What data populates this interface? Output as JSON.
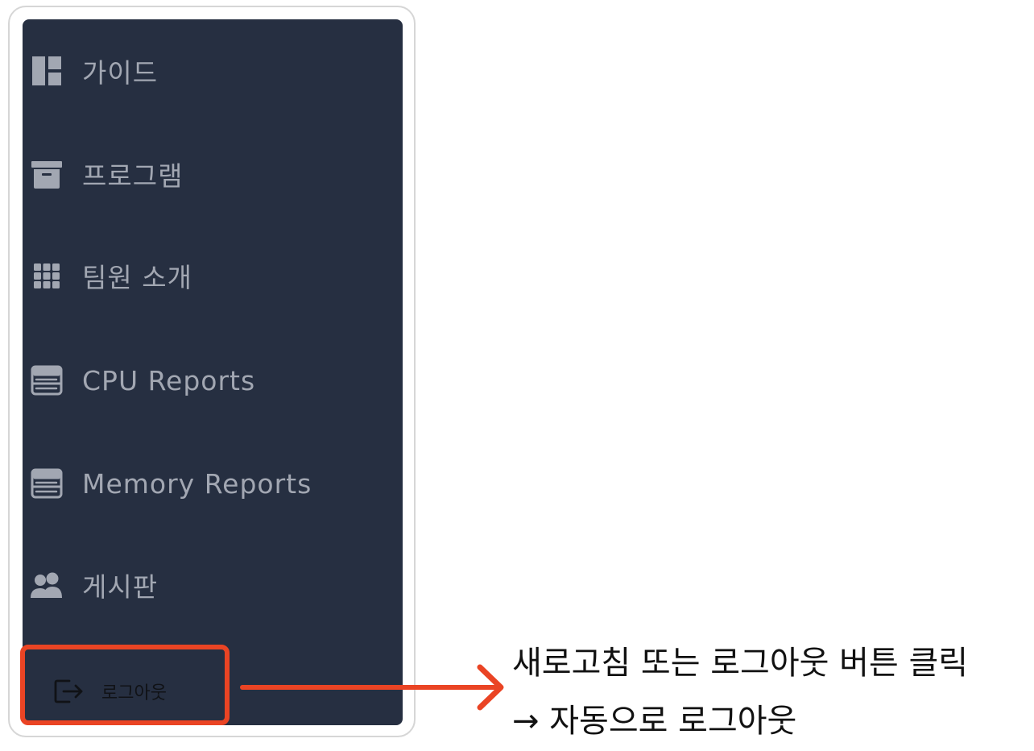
{
  "sidebar": {
    "items": [
      {
        "label": "가이드",
        "icon": "dashboard-icon"
      },
      {
        "label": "프로그램",
        "icon": "archive-icon"
      },
      {
        "label": "팀원 소개",
        "icon": "grid-icon"
      },
      {
        "label": "CPU Reports",
        "icon": "server-icon"
      },
      {
        "label": "Memory Reports",
        "icon": "server-icon"
      },
      {
        "label": "게시판",
        "icon": "users-icon"
      }
    ],
    "logout": {
      "label": "로그아웃",
      "icon": "logout-icon"
    }
  },
  "annotation": {
    "line1": "새로고침 또는 로그아웃 버튼 클릭",
    "line2": "→ 자동으로 로그아웃"
  },
  "colors": {
    "sidebar_bg": "#262f41",
    "sidebar_text": "#a2a7b2",
    "highlight": "#ea4424",
    "logout_text": "#101216"
  }
}
